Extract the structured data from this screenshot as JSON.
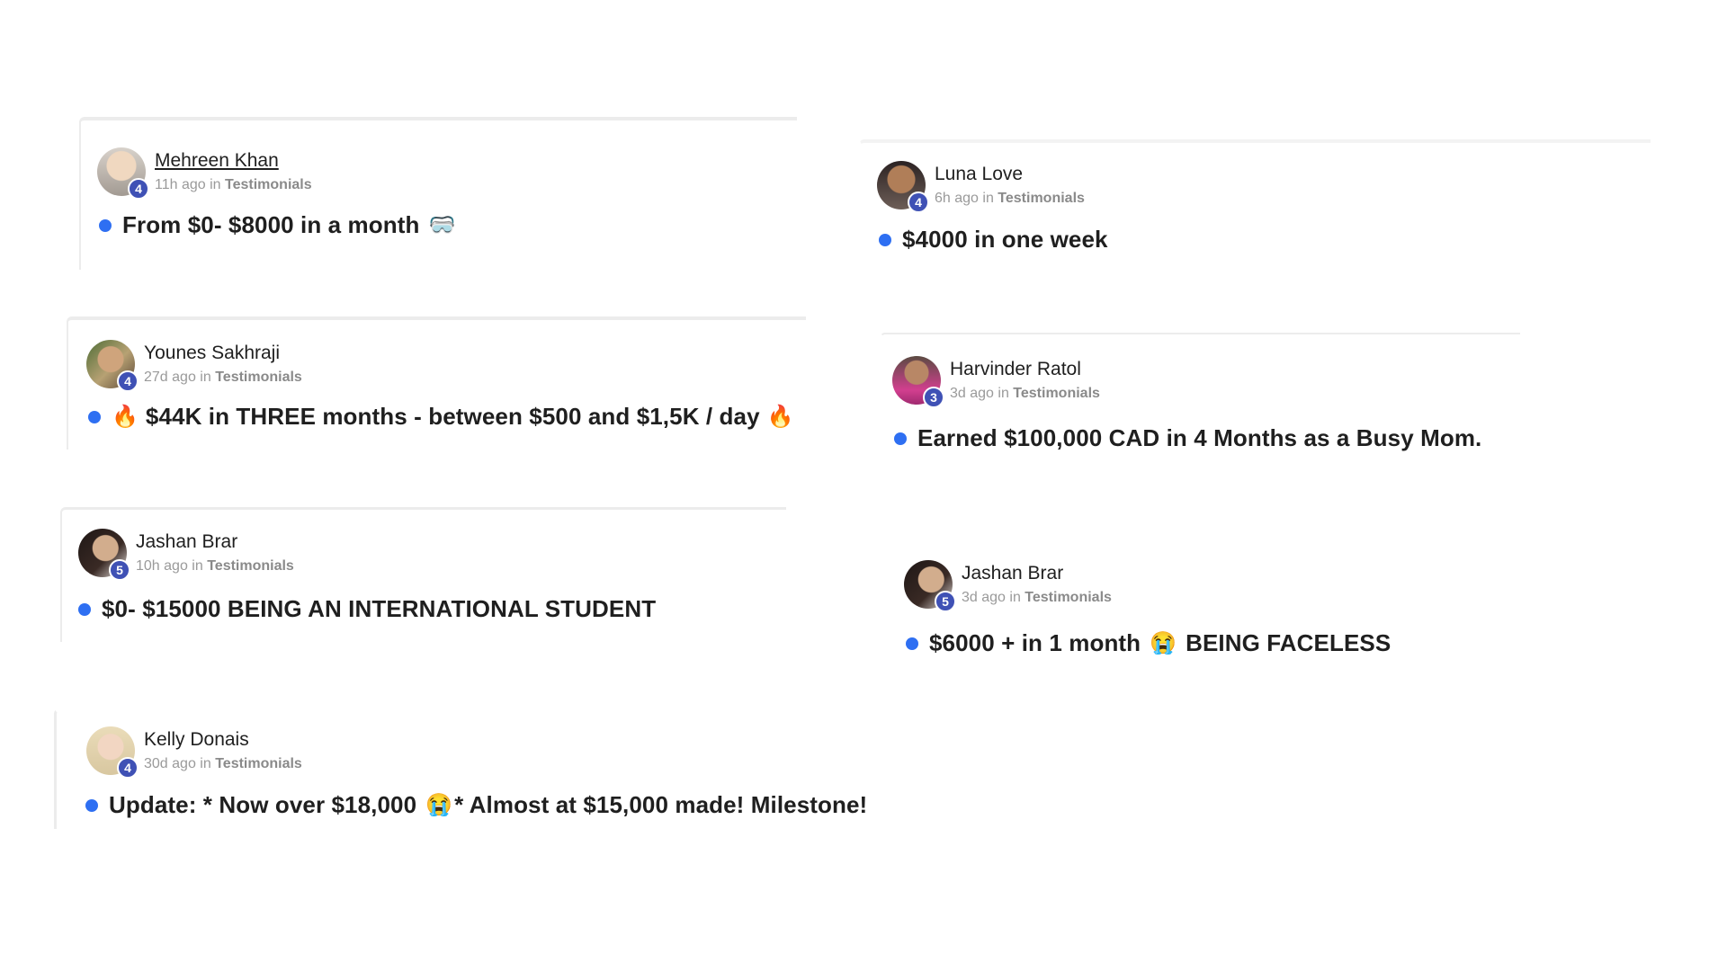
{
  "posts": [
    {
      "author": "Mehreen Khan",
      "badge": "4",
      "time": "11h ago",
      "in_label": "in",
      "category": "Testimonials",
      "title": "From $0- $8000 in a month",
      "emoji_end": "🥽"
    },
    {
      "author": "Luna Love",
      "badge": "4",
      "time": "6h ago",
      "in_label": "in",
      "category": "Testimonials",
      "title": "$4000 in one week"
    },
    {
      "author": "Younes Sakhraji",
      "badge": "4",
      "time": "27d ago",
      "in_label": "in",
      "category": "Testimonials",
      "emoji_start": "🔥",
      "title": "$44K in THREE months - between $500 and $1,5K / day",
      "emoji_end": "🔥"
    },
    {
      "author": "Harvinder Ratol",
      "badge": "3",
      "time": "3d ago",
      "in_label": "in",
      "category": "Testimonials",
      "title": "Earned $100,000 CAD in 4 Months as a Busy Mom."
    },
    {
      "author": "Jashan Brar",
      "badge": "5",
      "time": "10h ago",
      "in_label": "in",
      "category": "Testimonials",
      "title": "$0- $15000 BEING AN INTERNATIONAL STUDENT"
    },
    {
      "author": "Jashan Brar",
      "badge": "5",
      "time": "3d ago",
      "in_label": "in",
      "category": "Testimonials",
      "title_part1": "$6000 + in 1 month",
      "emoji_mid": "😭",
      "title_part2": "BEING FACELESS"
    },
    {
      "author": "Kelly Donais",
      "badge": "4",
      "time": "30d ago",
      "in_label": "in",
      "category": "Testimonials",
      "title_part1": "Update: * Now over $18,000",
      "emoji_mid": "😭",
      "title_part2": "* Almost at $15,000 made! Milestone!"
    }
  ]
}
